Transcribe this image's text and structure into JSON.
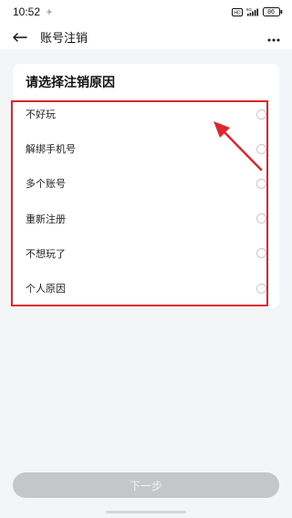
{
  "status_bar": {
    "time": "10:52",
    "notification_icon": "sparkle-icon",
    "network_label": "5G",
    "battery": "86"
  },
  "nav": {
    "title": "账号注销",
    "back_icon": "arrow-left-icon",
    "more_icon": "more-dots-icon"
  },
  "card": {
    "title": "请选择注销原因",
    "options": [
      {
        "label": "不好玩"
      },
      {
        "label": "解绑手机号"
      },
      {
        "label": "多个账号"
      },
      {
        "label": "重新注册"
      },
      {
        "label": "不想玩了"
      },
      {
        "label": "个人原因"
      }
    ]
  },
  "footer": {
    "next_label": "下一步"
  },
  "colors": {
    "annotation_red": "#e0262c",
    "button_disabled": "#c4c6c9",
    "page_background": "#f4f5f7"
  }
}
